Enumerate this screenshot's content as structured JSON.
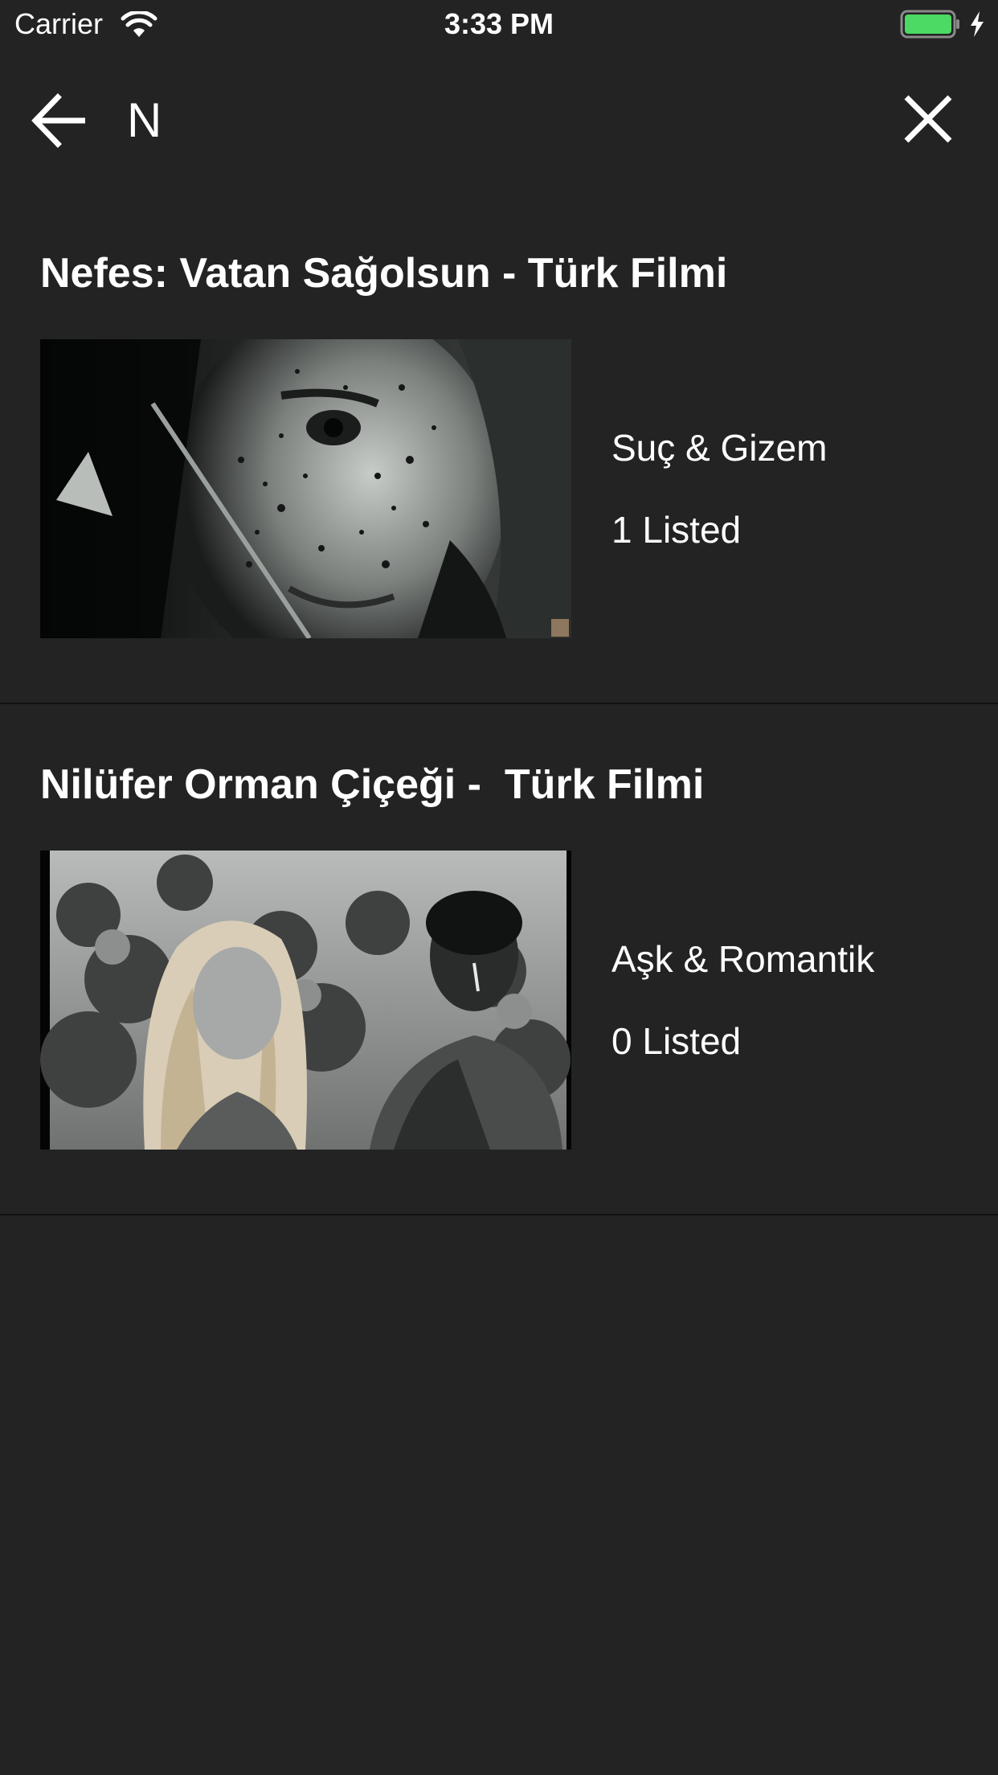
{
  "status_bar": {
    "carrier": "Carrier",
    "time": "3:33 PM",
    "battery_color": "#4cd964"
  },
  "search": {
    "query": "N",
    "back_icon": "arrow-left-icon",
    "close_icon": "close-icon"
  },
  "results": [
    {
      "title": "Nefes: Vatan Sağolsun - Türk Filmi",
      "genre": "Suç & Gizem",
      "listed": "1 Listed",
      "thumbnail": "black-and-white close-up of a man's face"
    },
    {
      "title": "Nilüfer Orman Çiçeği -  Türk Filmi",
      "genre": "Aşk & Romantik",
      "listed": "0 Listed",
      "thumbnail": "black-and-white still of a woman and a man in a forest"
    }
  ],
  "colors": {
    "background": "#232323",
    "text": "#ffffff",
    "separator": "#111111"
  }
}
